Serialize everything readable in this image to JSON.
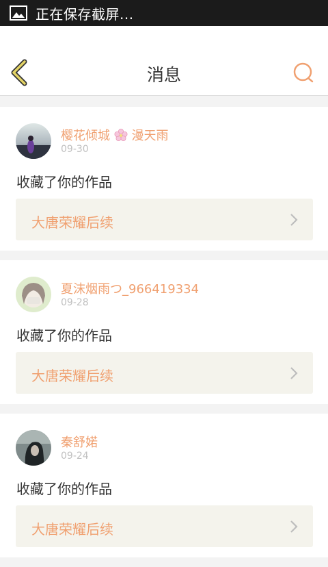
{
  "status_bar": {
    "text": "正在保存截屏...",
    "icon": "image-icon"
  },
  "header": {
    "title": "消息",
    "back_icon": "back-arrow-icon",
    "search_icon": "search-icon"
  },
  "messages": [
    {
      "username_part1": "樱花倾城",
      "username_part2": "漫天雨",
      "date": "09-30",
      "action": "收藏了你的作品",
      "work_title": "大唐荣耀后续"
    },
    {
      "username_part1": "夏沫烟雨つ_966419334",
      "date": "09-28",
      "action": "收藏了你的作品",
      "work_title": "大唐荣耀后续"
    },
    {
      "username_part1": "秦舒婼",
      "date": "09-24",
      "action": "收藏了你的作品",
      "work_title": "大唐荣耀后续"
    }
  ],
  "colors": {
    "accent": "#f0a070",
    "back_arrow": "#d9c860",
    "card_link_bg": "#f4f3ec",
    "status_bar_bg": "#1b1b1b"
  }
}
